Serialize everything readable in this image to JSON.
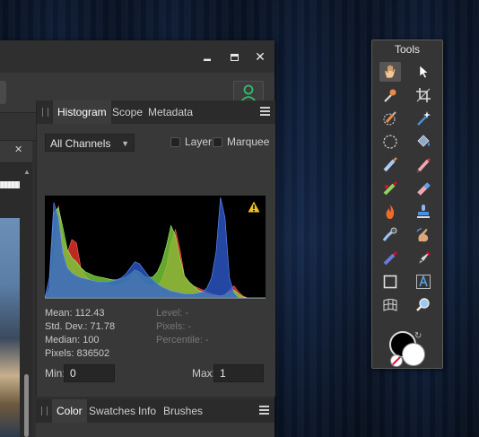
{
  "window": {
    "minimize_glyph": "▬",
    "maximize_glyph": "□",
    "close_glyph": "✕"
  },
  "doc": {
    "close_glyph": "✕"
  },
  "histogram_panel": {
    "tabs": [
      "Histogram",
      "Scope",
      "Metadata"
    ],
    "channel_select": "All Channels",
    "checkbox_layer": "Layer",
    "checkbox_marquee": "Marquee",
    "stats_left": [
      "Mean: 112.43",
      "Std. Dev.: 71.78",
      "Median: 100",
      "Pixels: 836502"
    ],
    "stats_right": [
      "Level: -",
      "Pixels: -",
      "Percentile: -"
    ],
    "min_label": "Min:",
    "min_value": "0",
    "max_label": "Max:",
    "max_value": "1"
  },
  "bottom_panel": {
    "tabs": [
      "Color",
      "Swatches",
      "Info",
      "Brushes"
    ]
  },
  "tools": {
    "title": "Tools",
    "items": [
      "view-tool",
      "move-tool",
      "color-picker-tool",
      "crop-tool",
      "selection-brush-tool",
      "flood-select-tool",
      "freehand-selection-tool",
      "flood-fill-tool",
      "paint-brush-tool",
      "pixel-tool",
      "healing-brush-tool",
      "erase-brush-tool",
      "burn-tool",
      "clone-tool",
      "smudge-tool",
      "dodge-tool",
      "blur-tool",
      "pen-tool",
      "rectangle-tool",
      "text-tool",
      "mesh-warp-tool",
      "zoom-tool"
    ]
  },
  "colors": {
    "accent": "#2ebd6b",
    "red": "#e0302a",
    "green": "#7bd13a",
    "blue": "#2f5fd8",
    "warning": "#f2c21b"
  },
  "chart_data": {
    "type": "area",
    "title": "",
    "xlabel": "",
    "ylabel": "",
    "xlim": [
      0,
      255
    ],
    "series": [
      {
        "color": "red",
        "values": [
          0,
          5,
          40,
          92,
          60,
          45,
          58,
          55,
          30,
          22,
          18,
          16,
          15,
          14,
          13,
          12,
          12,
          13,
          16,
          20,
          25,
          20,
          15,
          13,
          12,
          12,
          18,
          32,
          55,
          68,
          48,
          22,
          15,
          12,
          10,
          8,
          6,
          4,
          3,
          2,
          3,
          8,
          12,
          6,
          2,
          0,
          0,
          0,
          0,
          0
        ]
      },
      {
        "color": "green",
        "values": [
          0,
          10,
          85,
          90,
          70,
          48,
          40,
          36,
          30,
          26,
          24,
          22,
          21,
          20,
          19,
          18,
          18,
          19,
          21,
          24,
          28,
          26,
          22,
          20,
          21,
          26,
          36,
          52,
          72,
          62,
          40,
          22,
          16,
          12,
          8,
          6,
          4,
          3,
          2,
          2,
          3,
          6,
          8,
          4,
          1,
          0,
          0,
          0,
          0,
          0
        ]
      },
      {
        "color": "blue",
        "values": [
          0,
          20,
          95,
          80,
          45,
          30,
          25,
          22,
          20,
          19,
          18,
          17,
          16,
          16,
          16,
          17,
          18,
          20,
          24,
          30,
          36,
          34,
          28,
          22,
          18,
          14,
          11,
          9,
          7,
          6,
          5,
          4,
          4,
          4,
          5,
          6,
          10,
          20,
          45,
          100,
          80,
          20,
          5,
          0,
          0,
          0,
          0,
          0,
          0,
          0
        ]
      }
    ]
  }
}
